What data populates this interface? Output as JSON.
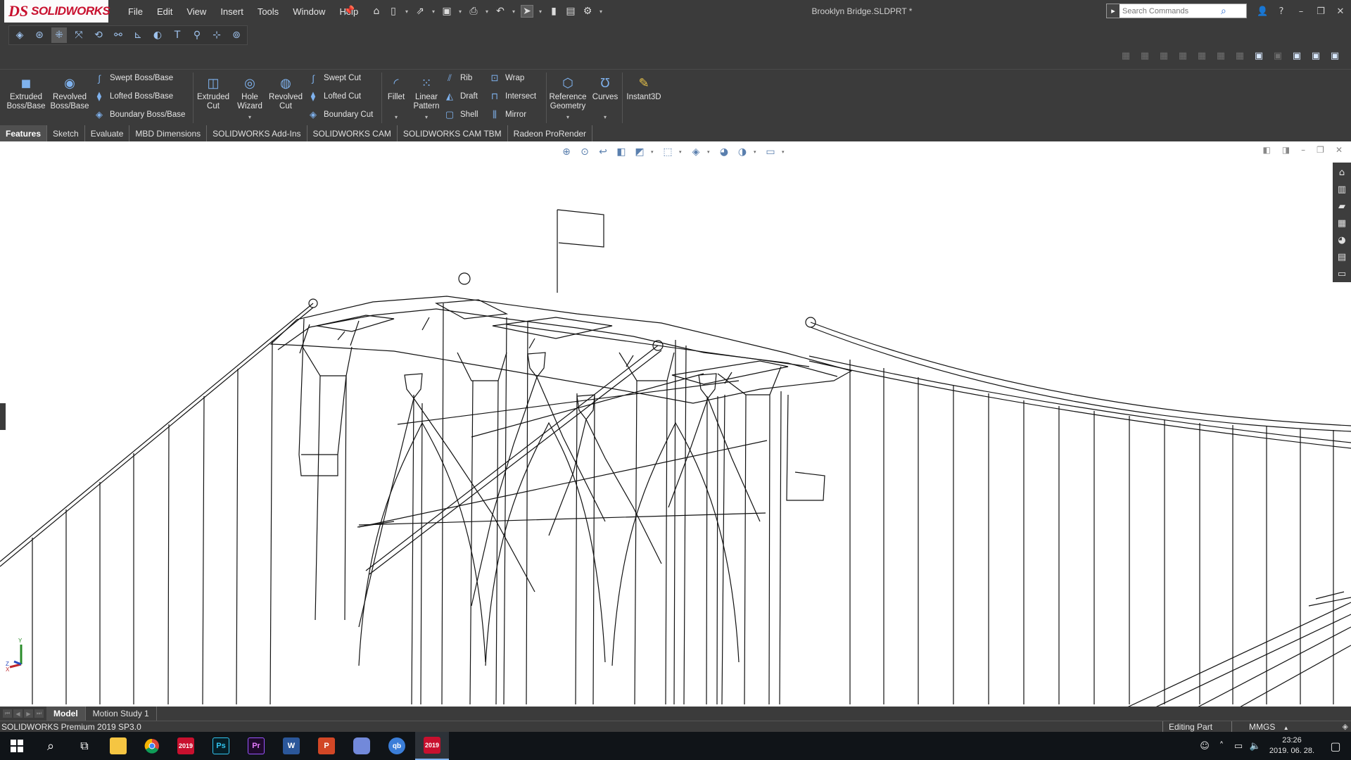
{
  "app": {
    "logo_mark": "DS",
    "logo_text": "SOLIDWORKS",
    "doc_title": "Brooklyn Bridge.SLDPRT *"
  },
  "menu": [
    "File",
    "Edit",
    "View",
    "Insert",
    "Tools",
    "Window",
    "Help"
  ],
  "search": {
    "placeholder": "Search Commands"
  },
  "features": {
    "extruded_boss": "Extruded Boss/Base",
    "revolved_boss": "Revolved Boss/Base",
    "swept_boss": "Swept Boss/Base",
    "lofted_boss": "Lofted Boss/Base",
    "boundary_boss": "Boundary Boss/Base",
    "extruded_cut": "Extruded Cut",
    "hole_wizard": "Hole Wizard",
    "revolved_cut": "Revolved Cut",
    "swept_cut": "Swept Cut",
    "lofted_cut": "Lofted Cut",
    "boundary_cut": "Boundary Cut",
    "fillet": "Fillet",
    "linear_pattern": "Linear Pattern",
    "rib": "Rib",
    "draft": "Draft",
    "shell": "Shell",
    "wrap": "Wrap",
    "intersect": "Intersect",
    "mirror": "Mirror",
    "reference_geometry": "Reference Geometry",
    "curves": "Curves",
    "instant3d": "Instant3D"
  },
  "tabs": [
    "Features",
    "Sketch",
    "Evaluate",
    "MBD Dimensions",
    "SOLIDWORKS Add-Ins",
    "SOLIDWORKS CAM",
    "SOLIDWORKS CAM TBM",
    "Radeon ProRender"
  ],
  "active_tab": "Features",
  "bottom_tabs": [
    "Model",
    "Motion Study 1"
  ],
  "status": {
    "version": "SOLIDWORKS Premium 2019 SP3.0",
    "mode": "Editing Part",
    "units": "MMGS"
  },
  "triad": {
    "x_label": "X",
    "y_label": "Y",
    "z_label": "Z"
  },
  "taskbar": {
    "apps": [
      {
        "name": "start",
        "icon": "windows-icon"
      },
      {
        "name": "search",
        "icon": "search-icon"
      },
      {
        "name": "task-view",
        "icon": "task-view-icon"
      },
      {
        "name": "file-explorer",
        "icon": "folder-icon"
      },
      {
        "name": "chrome",
        "icon": "chrome-icon"
      },
      {
        "name": "solidworks-2019",
        "icon": "solidworks-icon",
        "label": "2019"
      },
      {
        "name": "photoshop",
        "icon": "photoshop-icon",
        "label": "Ps"
      },
      {
        "name": "premiere",
        "icon": "premiere-icon",
        "label": "Pr"
      },
      {
        "name": "word",
        "icon": "word-icon",
        "label": "W"
      },
      {
        "name": "powerpoint",
        "icon": "powerpoint-icon",
        "label": "P"
      },
      {
        "name": "discord",
        "icon": "discord-icon"
      },
      {
        "name": "qbittorrent",
        "icon": "qbittorrent-icon",
        "label": "qb"
      },
      {
        "name": "solidworks-active",
        "icon": "solidworks-icon",
        "label": "2019"
      }
    ],
    "time": "23:26",
    "date": "2019. 06. 28."
  },
  "colors": {
    "chrome_bg": "#3b3b3b",
    "accent": "#c8102e",
    "icon_blue": "#7fb2ee"
  }
}
